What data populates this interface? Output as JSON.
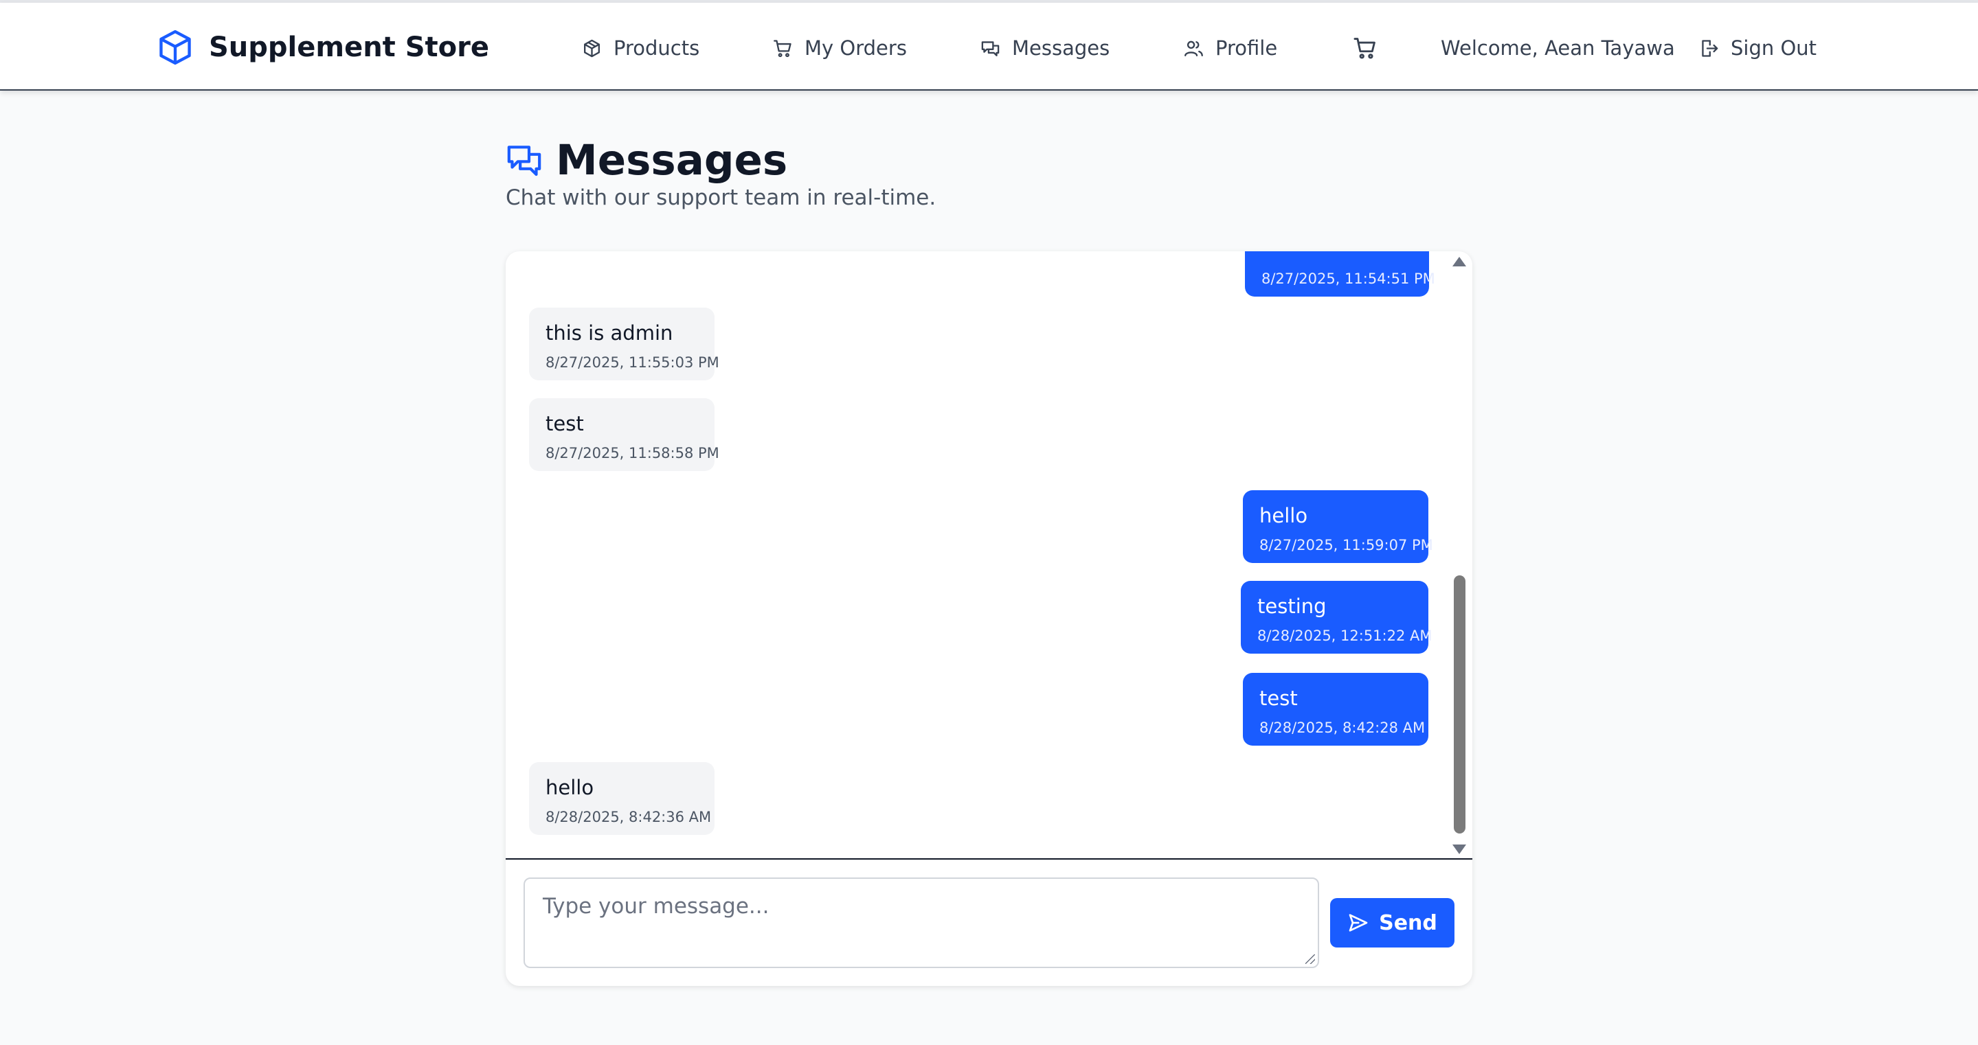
{
  "app": {
    "name": "Supplement Store",
    "brand_color": "#1a5cff"
  },
  "nav": {
    "products": "Products",
    "orders": "My Orders",
    "messages": "Messages",
    "profile": "Profile",
    "welcome": "Welcome, Aean Tayawa",
    "sign_out": "Sign Out"
  },
  "page": {
    "title": "Messages",
    "subtitle": "Chat with our support team in real-time."
  },
  "messages": [
    {
      "direction": "outgoing",
      "text": "",
      "time": "8/27/2025, 11:54:51 PM"
    },
    {
      "direction": "incoming",
      "text": "this is admin",
      "time": "8/27/2025, 11:55:03 PM"
    },
    {
      "direction": "incoming",
      "text": "test",
      "time": "8/27/2025, 11:58:58 PM"
    },
    {
      "direction": "outgoing",
      "text": "hello",
      "time": "8/27/2025, 11:59:07 PM"
    },
    {
      "direction": "outgoing",
      "text": "testing",
      "time": "8/28/2025, 12:51:22 AM"
    },
    {
      "direction": "outgoing",
      "text": "test",
      "time": "8/28/2025, 8:42:28 AM"
    },
    {
      "direction": "incoming",
      "text": "hello",
      "time": "8/28/2025, 8:42:36 AM"
    }
  ],
  "composer": {
    "placeholder": "Type your message...",
    "value": "",
    "send_label": "Send"
  },
  "colors": {
    "outgoing_bubble": "#1a5cff",
    "incoming_bubble": "#f3f4f6",
    "page_bg": "#f9fafb"
  }
}
